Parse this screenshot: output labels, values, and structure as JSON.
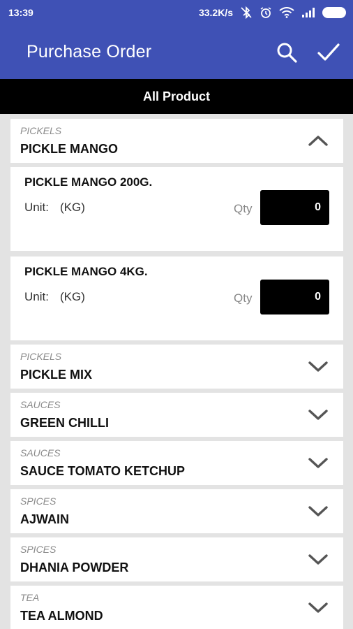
{
  "status": {
    "time": "13:39",
    "speed": "33.2K/s"
  },
  "app_bar": {
    "title": "Purchase Order"
  },
  "filter": {
    "label": "All Product"
  },
  "groups": [
    {
      "category": "PICKELS",
      "name": "PICKLE MANGO",
      "expanded": true,
      "products": [
        {
          "name": "PICKLE MANGO 200G.",
          "unit_label": "Unit:",
          "unit": "(KG)",
          "qty_label": "Qty",
          "qty": "0"
        },
        {
          "name": "PICKLE MANGO 4KG.",
          "unit_label": "Unit:",
          "unit": "(KG)",
          "qty_label": "Qty",
          "qty": "0"
        }
      ]
    },
    {
      "category": "PICKELS",
      "name": "PICKLE MIX",
      "expanded": false
    },
    {
      "category": "SAUCES",
      "name": "GREEN CHILLI",
      "expanded": false
    },
    {
      "category": "SAUCES",
      "name": "SAUCE TOMATO KETCHUP",
      "expanded": false
    },
    {
      "category": "SPICES",
      "name": "AJWAIN",
      "expanded": false
    },
    {
      "category": "SPICES",
      "name": "DHANIA POWDER",
      "expanded": false
    },
    {
      "category": "TEA",
      "name": "TEA ALMOND",
      "expanded": false
    }
  ],
  "colors": {
    "primary": "#3f51b5",
    "filter_bar": "#000000",
    "background": "#e3e3e3",
    "card": "#ffffff"
  },
  "icons": {
    "search": "search-icon",
    "confirm": "checkmark-icon",
    "expand": "chevron-down-icon",
    "collapse": "chevron-up-icon"
  }
}
